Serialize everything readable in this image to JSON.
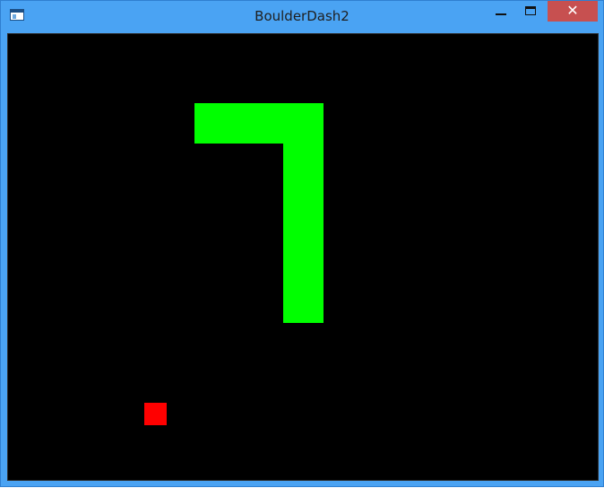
{
  "window": {
    "title": "BoulderDash2",
    "close_glyph": "✕",
    "frame_color": "#4aa3f3",
    "close_color": "#c75050"
  },
  "game": {
    "background_color": "#000000",
    "wall_color": "#00ff00",
    "player_color": "#ff0000"
  }
}
